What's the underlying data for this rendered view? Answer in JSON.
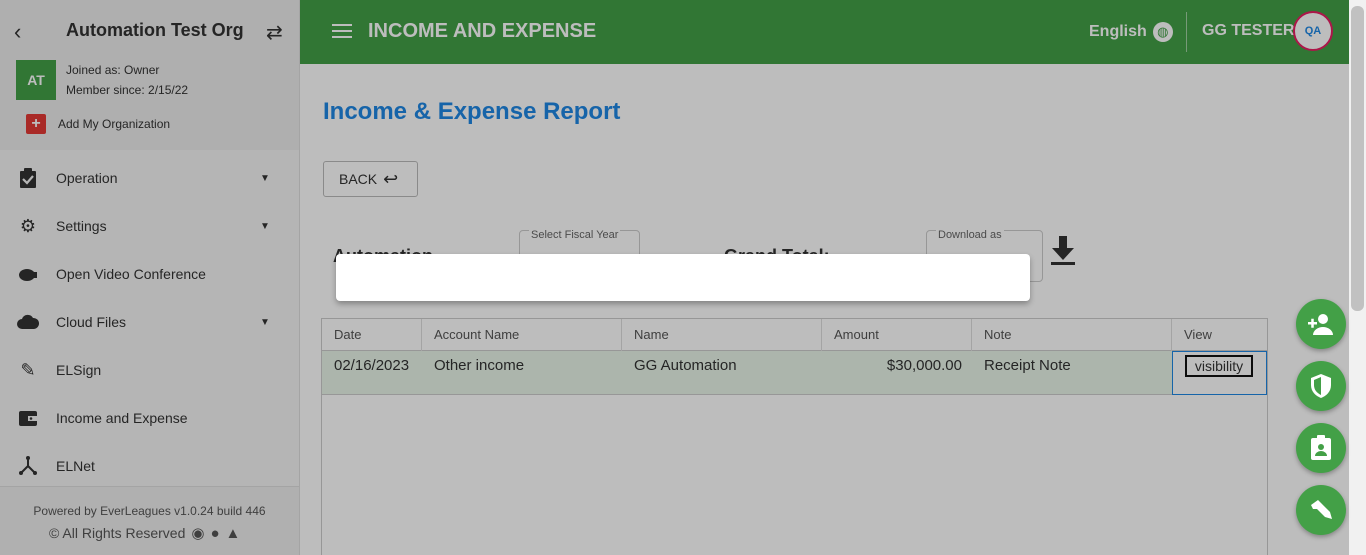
{
  "sidebar": {
    "org_title": "Automation Test Org",
    "avatar_initials": "AT",
    "joined_as": "Joined as: Owner",
    "member_since": "Member since: 2/15/22",
    "add_org_label": "Add My Organization",
    "items": [
      {
        "label": "Operation",
        "icon": "clipboard-check-icon",
        "has_caret": true
      },
      {
        "label": "Settings",
        "icon": "gear-icon",
        "has_caret": true
      },
      {
        "label": "Open Video Conference",
        "icon": "video-icon",
        "has_caret": false
      },
      {
        "label": "Cloud Files",
        "icon": "cloud-icon",
        "has_caret": true
      },
      {
        "label": "ELSign",
        "icon": "pencil-icon",
        "has_caret": false
      },
      {
        "label": "Income and Expense",
        "icon": "wallet-icon",
        "has_caret": false
      },
      {
        "label": "ELNet",
        "icon": "network-icon",
        "has_caret": false
      }
    ],
    "footer": {
      "powered_by": "Powered by EverLeagues v1.0.24 build 446",
      "rights": "© All Rights Reserved"
    }
  },
  "appbar": {
    "title": "INCOME AND EXPENSE",
    "language": "English",
    "user_name": "GG TESTER",
    "user_avatar_text": "QA",
    "color": "#43a047"
  },
  "main": {
    "page_title": "Income & Expense Report",
    "back_button": "BACK",
    "org_label_partial": "Automation",
    "fiscal_year_label": "Select Fiscal Year",
    "grand_total_partial": "Grand Total:",
    "download_label": "Download as",
    "table": {
      "headers": [
        "Date",
        "Account Name",
        "Name",
        "Amount",
        "Note",
        "View"
      ],
      "rows": [
        {
          "date": "02/16/2023",
          "account": "Other income",
          "name": "GG Automation",
          "amount": "$30,000.00",
          "note": "Receipt Note",
          "view": "visibility"
        }
      ]
    }
  },
  "colors": {
    "accent": "#43a047",
    "title_blue": "#1e88e5",
    "row_highlight": "#e8f5e9"
  }
}
